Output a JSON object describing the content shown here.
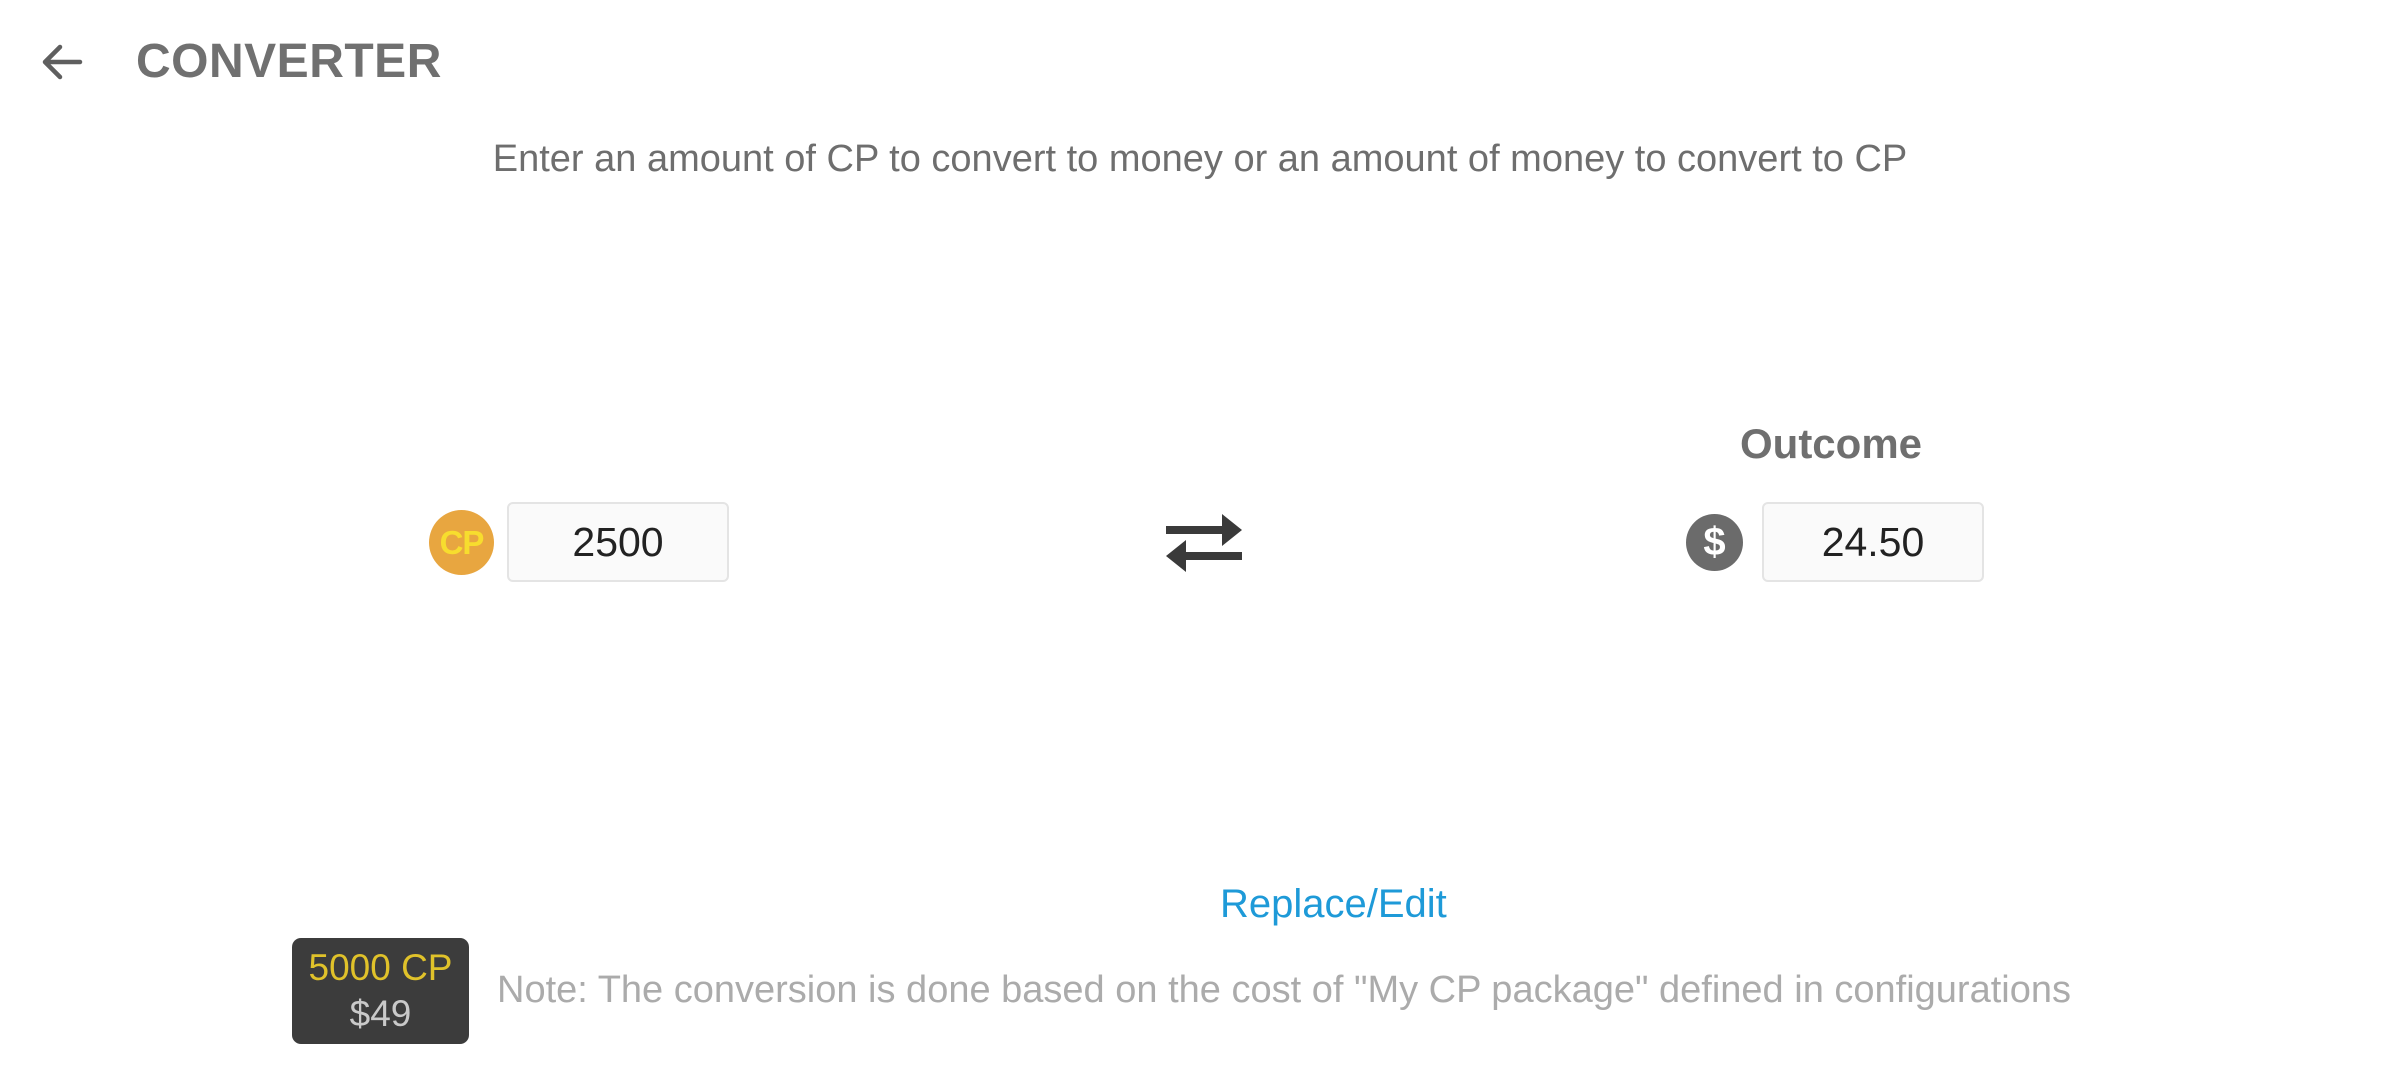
{
  "header": {
    "back_icon": "arrow-left-icon",
    "title": "CONVERTER"
  },
  "instructions": "Enter an amount of CP to convert to money or an amount of money to convert to CP",
  "converter": {
    "cp_icon_label": "CP",
    "cp_amount": "2500",
    "swap_icon": "swap-arrows-icon",
    "outcome_label": "Outcome",
    "money_icon": "dollar-circle-icon",
    "money_amount": "24.50"
  },
  "footer": {
    "replace_edit_label": "Replace/Edit",
    "package": {
      "cp": "5000 CP",
      "price": "$49"
    },
    "note": "Note: The conversion is done based on the cost of \"My CP package\" defined in configurations"
  },
  "colors": {
    "accent_link": "#1E9AD8",
    "coin_bg": "#E8A640",
    "coin_text": "#F7DD2E",
    "badge_bg": "#3c3c3c",
    "badge_cp": "#E0C22A"
  }
}
